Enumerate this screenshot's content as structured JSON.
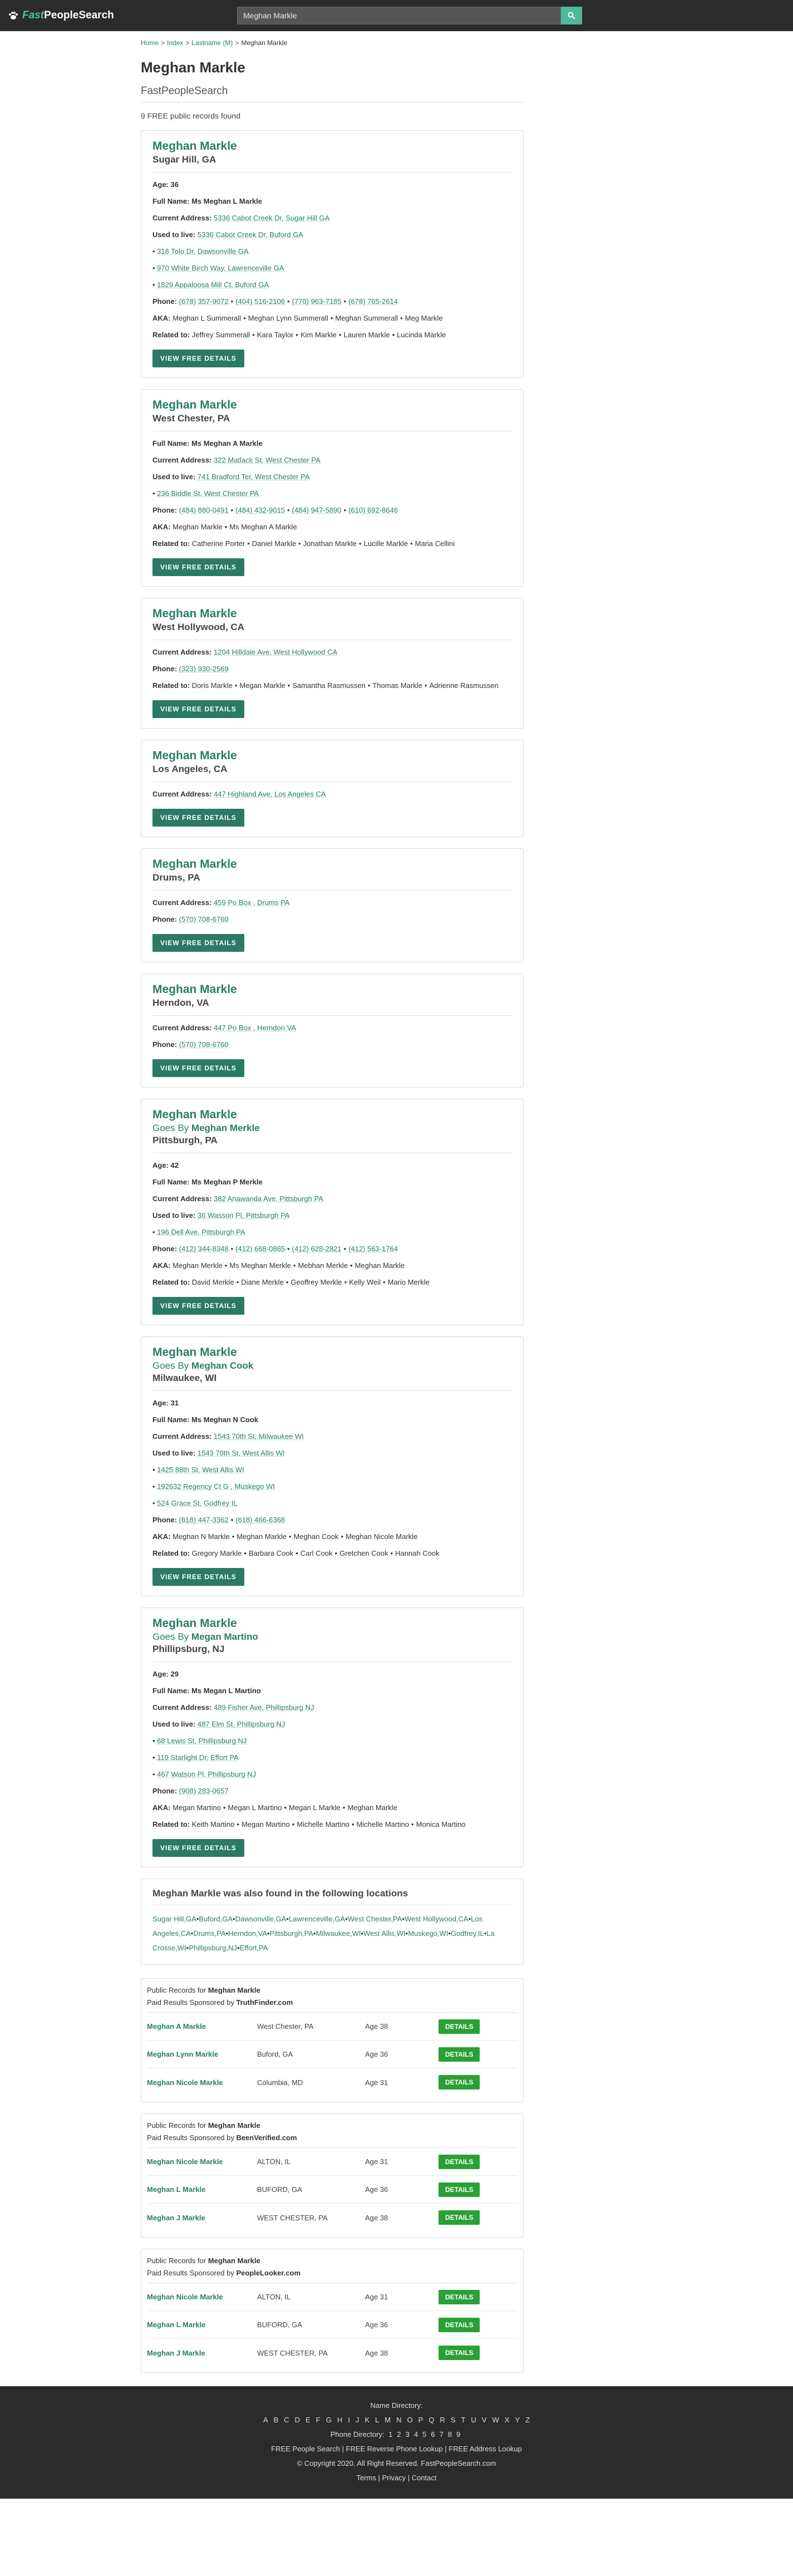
{
  "header": {
    "brand_fast": "Fast",
    "brand_people": "PeopleSearch",
    "search_value": "Meghan Markle"
  },
  "breadcrumb": [
    "Home",
    "Index",
    "Lastname (M)",
    "Meghan Markle"
  ],
  "page": {
    "title": "Meghan Markle",
    "subtitle": "FastPeopleSearch",
    "count_text": "9 FREE public records found"
  },
  "labels": {
    "age": "Age:",
    "full_name": "Full Name:",
    "current_address": "Current Address:",
    "used_to_live": "Used to live:",
    "phone": "Phone:",
    "aka": "AKA:",
    "related_to": "Related to:",
    "goes_by": "Goes By",
    "view_free_details": "VIEW FREE DETAILS"
  },
  "records": [
    {
      "name": "Meghan Markle",
      "location": "Sugar Hill, GA",
      "age": "36",
      "full_name": "Ms Meghan L Markle",
      "current_address": "5336 Cabot Creek Dr, Sugar Hill GA",
      "used_to_live": [
        "5336 Cabot Creek Dr, Buford GA",
        "318 Tolo Dr, Dawsonville GA",
        "970 White Birch Way, Lawrenceville GA",
        "1829 Appaloosa Mill Ct, Buford GA"
      ],
      "phones": [
        "(678) 357-9072",
        "(404) 516-2106",
        "(770) 963-7185",
        "(678) 765-2614"
      ],
      "aka": [
        "Meghan L Summerall",
        "Meghan Lynn Summerall",
        "Meghan Summerall",
        "Meg Markle"
      ],
      "related": [
        "Jeffrey Summerall",
        "Kara Taylor",
        "Kim Markle",
        "Lauren Markle",
        "Lucinda Markle"
      ]
    },
    {
      "name": "Meghan Markle",
      "location": "West Chester, PA",
      "full_name": "Ms Meghan A Markle",
      "current_address": "322 Matlack St, West Chester PA",
      "used_to_live": [
        "741 Bradford Ter, West Chester PA",
        "236 Biddle St, West Chester PA"
      ],
      "phones": [
        "(484) 880-0491",
        "(484) 432-9015",
        "(484) 947-5890",
        "(610) 692-8646"
      ],
      "aka": [
        "Meghan Markle",
        "Ms Meghan A Markle"
      ],
      "related": [
        "Catherine Porter",
        "Daniel Markle",
        "Jonathan Markle",
        "Lucille Markle",
        "Maria Cellini"
      ]
    },
    {
      "name": "Meghan Markle",
      "location": "West Hollywood, CA",
      "current_address": "1204 Hilldale Ave, West Hollywood CA",
      "phones": [
        "(323) 930-2569"
      ],
      "related": [
        "Doris Markle",
        "Megan Markle",
        "Samantha Rasmussen",
        "Thomas Markle",
        "Adrienne Rasmussen"
      ]
    },
    {
      "name": "Meghan Markle",
      "location": "Los Angeles, CA",
      "current_address": "447 Highland Ave, Los Angeles CA"
    },
    {
      "name": "Meghan Markle",
      "location": "Drums, PA",
      "current_address": "459 Po Box , Drums PA",
      "phones": [
        "(570) 708-6760"
      ]
    },
    {
      "name": "Meghan Markle",
      "location": "Herndon, VA",
      "current_address": "447 Po Box , Herndon VA",
      "phones": [
        "(570) 708-6760"
      ]
    },
    {
      "name": "Meghan Markle",
      "goes_by": "Meghan Merkle",
      "location": "Pittsburgh, PA",
      "age": "42",
      "full_name": "Ms Meghan P Merkle",
      "current_address": "382 Anawanda Ave, Pittsburgh PA",
      "used_to_live": [
        "36 Wasson Pl, Pittsburgh PA",
        "196 Dell Ave, Pittsburgh PA"
      ],
      "phones": [
        "(412) 344-8348",
        "(412) 668-0865",
        "(412) 628-2821",
        "(412) 563-1764"
      ],
      "aka": [
        "Meghan Merkle",
        "Ms Meghan Merkle",
        "Mebhan Merkle",
        "Meghan Markle"
      ],
      "related": [
        "David Merkle",
        "Diane Merkle",
        "Geoffrey Merkle",
        "Kelly Weil",
        "Mario Merkle"
      ]
    },
    {
      "name": "Meghan Markle",
      "goes_by": "Meghan Cook",
      "location": "Milwaukee, WI",
      "age": "31",
      "full_name": "Ms Meghan N Cook",
      "current_address": "1543 70th St, Milwaukee WI",
      "used_to_live": [
        "1543 70th St, West Allis WI",
        "1425 88th St, West Allis WI",
        "192632 Regency Ct G , Muskego WI",
        "524 Grace St, Godfrey IL"
      ],
      "phones": [
        "(618) 447-3362",
        "(618) 466-6368"
      ],
      "aka": [
        "Meghan N Markle",
        "Meghan Markle",
        "Meghan Cook",
        "Meghan Nicole Markle"
      ],
      "related": [
        "Gregory Markle",
        "Barbara Cook",
        "Carl Cook",
        "Gretchen Cook",
        "Hannah Cook"
      ]
    },
    {
      "name": "Meghan Markle",
      "goes_by": "Megan Martino",
      "location": "Phillipsburg, NJ",
      "age": "29",
      "full_name": "Ms Megan L Martino",
      "current_address": "489 Fisher Ave, Phillipsburg NJ",
      "used_to_live": [
        "487 Elm St, Phillipsburg NJ",
        "68 Lewis St, Phillipsburg NJ",
        "110 Starlight Dr, Effort PA",
        "467 Watson Pl, Phillipsburg NJ"
      ],
      "phones": [
        "(908) 283-0657"
      ],
      "aka": [
        "Megan Martino",
        "Megan L Martino",
        "Megan L Markle",
        "Meghan Markle"
      ],
      "related": [
        "Keith Martino",
        "Megan Martino",
        "Michelle Martino",
        "Michelle Martino",
        "Monica Martino"
      ]
    }
  ],
  "also_found": {
    "title": "Meghan Markle was also found in the following locations",
    "locations": [
      "Sugar Hill,GA",
      "Buford,GA",
      "Dawsonville,GA",
      "Lawrenceville,GA",
      "West Chester,PA",
      "West Hollywood,CA",
      "Los Angeles,CA",
      "Drums,PA",
      "Herndon,VA",
      "Pittsburgh,PA",
      "Milwaukee,WI",
      "West Allis,WI",
      "Muskego,WI",
      "Godfrey,IL",
      "La Crosse,WI",
      "Phillipsburg,NJ",
      "Effort,PA"
    ]
  },
  "paid_labels": {
    "public_records_for": "Public Records for",
    "sponsored_by": "Paid Results Sponsored by",
    "details": "DETAILS"
  },
  "paid_blocks": [
    {
      "sponsor": "TruthFinder.com",
      "rows": [
        {
          "name": "Meghan A Markle",
          "location": "West Chester, PA",
          "age": "Age 38"
        },
        {
          "name": "Meghan Lynn Markle",
          "location": "Buford, GA",
          "age": "Age 36"
        },
        {
          "name": "Meghan Nicole Markle",
          "location": "Columbia, MD",
          "age": "Age 31"
        }
      ]
    },
    {
      "sponsor": "BeenVerified.com",
      "rows": [
        {
          "name": "Meghan Nicole Markle",
          "location": "ALTON, IL",
          "age": "Age 31"
        },
        {
          "name": "Meghan L Markle",
          "location": "BUFORD, GA",
          "age": "Age 36"
        },
        {
          "name": "Meghan J Markle",
          "location": "WEST CHESTER, PA",
          "age": "Age 38"
        }
      ]
    },
    {
      "sponsor": "PeopleLooker.com",
      "rows": [
        {
          "name": "Meghan Nicole Markle",
          "location": "ALTON, IL",
          "age": "Age 31"
        },
        {
          "name": "Meghan L Markle",
          "location": "BUFORD, GA",
          "age": "Age 36"
        },
        {
          "name": "Meghan J Markle",
          "location": "WEST CHESTER, PA",
          "age": "Age 38"
        }
      ]
    }
  ],
  "footer": {
    "name_directory": "Name Directory:",
    "letters": [
      "A",
      "B",
      "C",
      "D",
      "E",
      "F",
      "G",
      "H",
      "I",
      "J",
      "K",
      "L",
      "M",
      "N",
      "O",
      "P",
      "Q",
      "R",
      "S",
      "T",
      "U",
      "V",
      "W",
      "X",
      "Y",
      "Z"
    ],
    "phone_directory": "Phone Directory:",
    "numbers": [
      "1",
      "2",
      "3",
      "4",
      "5",
      "6",
      "7",
      "8",
      "9"
    ],
    "links": [
      "FREE People Search",
      "FREE Reverse Phone Lookup",
      "FREE Address Lookup"
    ],
    "copyright": "© Copyright 2020. All Right Reserved. FastPeopleSearch.com",
    "legal": [
      "Terms",
      "Privacy",
      "Contact"
    ]
  },
  "colors": {
    "header_bg": "#2b2b2b",
    "accent": "#267f69",
    "button": "#2b7a66",
    "details_button": "#2aa036"
  }
}
